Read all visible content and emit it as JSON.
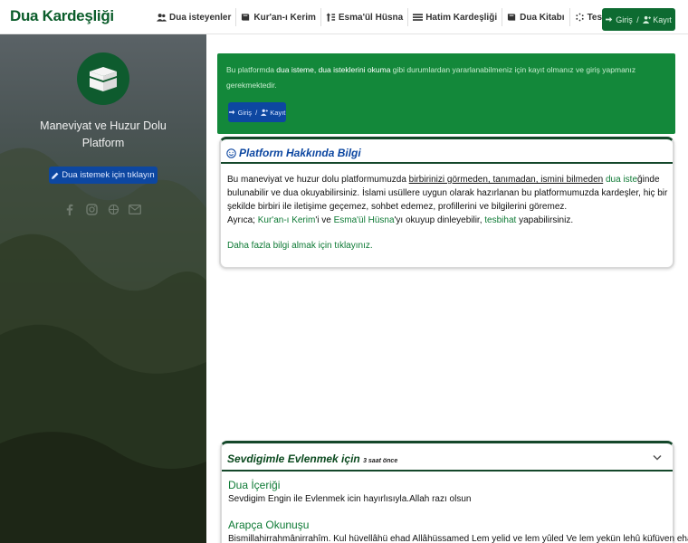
{
  "brand": "Dua Kardeşliği",
  "nav": {
    "items": [
      {
        "label": "Dua isteyenler",
        "icon": "users-icon"
      },
      {
        "label": "Kur'an-ı Kerim",
        "icon": "book-icon"
      },
      {
        "label": "Esma'ül Hüsna",
        "icon": "sort-icon"
      },
      {
        "label": "Hatim Kardeşliği",
        "icon": "list-icon"
      },
      {
        "label": "Dua Kitabı",
        "icon": "book-icon"
      },
      {
        "label": "Tesbihat",
        "icon": "spinner-icon"
      }
    ],
    "login": "Giriş",
    "register": "Kayıt"
  },
  "sidebar": {
    "title_line1": "Maneviyat ve Huzur Dolu",
    "title_line2": "Platform",
    "button": "Dua istemek için tıklayın",
    "social": [
      "facebook-icon",
      "instagram-icon",
      "web-icon",
      "mail-icon"
    ]
  },
  "alert": {
    "text_a": "Bu platformda ",
    "text_b": "dua isteme, dua isteklerini okuma",
    "text_c": " gibi durumlardan yararlanabilmeniz için kayıt olmanız ve giriş yapmanız gerekmektedir.",
    "login": "Giriş",
    "register": "Kayıt"
  },
  "info_card": {
    "title": "Platform Hakkında Bilgi",
    "p1_a": "Bu maneviyat ve huzur dolu platformumuzda ",
    "p1_b": "birbirinizi görmeden, tanımadan, ismini bilmeden",
    "p1_c": " ",
    "p1_d": "dua iste",
    "p1_e": "ğinde bulunabilir ve dua okuyabilirsiniz. İslami usüllere uygun olarak hazırlanan bu platformumuzda kardeşler, hiç bir şekilde birbiri ile iletişime geçemez, sohbet edemez, profillerini ve bilgilerini göremez.",
    "p2_a": "Ayrıca; ",
    "p2_b": "Kur'an-ı Kerim",
    "p2_c": "'i ve ",
    "p2_d": "Esma'ül Hüsna",
    "p2_e": "'yı okuyup dinleyebilir, ",
    "p2_f": "tesbihat",
    "p2_g": " yapabilirsiniz.",
    "more": "Daha fazla bilgi almak için tıklayınız."
  },
  "dua_card": {
    "title": "Sevdigimle Evlenmek için",
    "time": "3 saat önce",
    "content_heading": "Dua İçeriği",
    "content_text": "Sevdigim Engin ile Evlenmek icin hayırlısıyla.Allah razı olsun",
    "arabic_heading": "Arapça Okunuşu",
    "arabic_text": "Bismillahirrahmânirrahîm. Kul hüvellâhü ehad Allâhüssamed Lem yelid ve lem yûled Ve lem yekün lehû küfüven ehad"
  },
  "colors": {
    "brand_green": "#0b5d2b",
    "alert_green": "#13883a",
    "button_blue": "#0d47a1"
  }
}
